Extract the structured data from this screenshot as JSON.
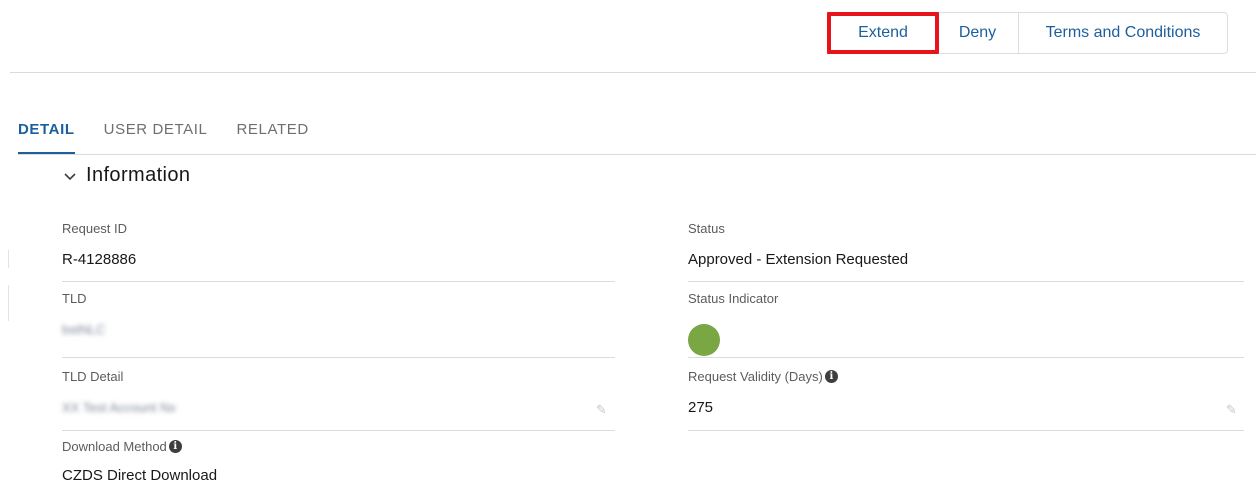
{
  "actions": {
    "extend": "Extend",
    "deny": "Deny",
    "terms": "Terms and Conditions"
  },
  "tabs": [
    "DETAIL",
    "USER DETAIL",
    "RELATED"
  ],
  "active_tab": "DETAIL",
  "section": {
    "title": "Information"
  },
  "fields": {
    "request_id": {
      "label": "Request ID",
      "value": "R-4128886"
    },
    "tld": {
      "label": "TLD",
      "value": "bstNLC"
    },
    "tld_detail": {
      "label": "TLD Detail",
      "value": "XX Test Account Nx"
    },
    "download_method": {
      "label": "Download Method",
      "value": "CZDS Direct Download"
    },
    "status": {
      "label": "Status",
      "value": "Approved - Extension Requested"
    },
    "status_indicator": {
      "label": "Status Indicator",
      "color": "#7aa644"
    },
    "request_validity": {
      "label": "Request Validity (Days)",
      "value": "275"
    }
  },
  "colors": {
    "accent": "#1b5f9e",
    "highlight": "#e8141c"
  }
}
